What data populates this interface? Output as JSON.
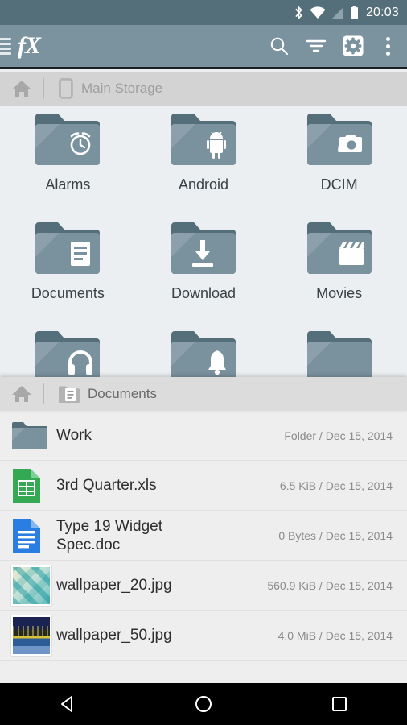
{
  "statusbar": {
    "time": "20:03",
    "icons": [
      "bluetooth-icon",
      "wifi-icon",
      "signal-icon",
      "battery-icon"
    ]
  },
  "appbar": {
    "menu_icon": "hamburger-menu-icon",
    "logo": "fX",
    "actions": [
      {
        "name": "search-button",
        "icon": "search-icon"
      },
      {
        "name": "filter-button",
        "icon": "filter-icon"
      },
      {
        "name": "settings-button",
        "icon": "gear-icon"
      },
      {
        "name": "overflow-button",
        "icon": "more-vertical-icon"
      }
    ]
  },
  "panel_top": {
    "breadcrumb": {
      "home_icon": "home-icon",
      "device_icon": "phone-icon",
      "label": "Main Storage"
    },
    "folders": [
      {
        "label": "Alarms",
        "icon": "alarm-clock-icon"
      },
      {
        "label": "Android",
        "icon": "android-robot-icon"
      },
      {
        "label": "DCIM",
        "icon": "camera-icon"
      },
      {
        "label": "Documents",
        "icon": "document-icon"
      },
      {
        "label": "Download",
        "icon": "download-arrow-icon"
      },
      {
        "label": "Movies",
        "icon": "clapperboard-icon"
      },
      {
        "label": "",
        "icon": "headphones-icon"
      },
      {
        "label": "",
        "icon": "bell-icon"
      },
      {
        "label": "",
        "icon": "plain-folder-icon"
      }
    ]
  },
  "panel_bottom": {
    "breadcrumb": {
      "home_icon": "home-icon",
      "folder_icon": "documents-folder-icon",
      "label": "Documents"
    },
    "files": [
      {
        "name": "Work",
        "meta": "Folder / Dec 15, 2014",
        "icon": "folder-icon"
      },
      {
        "name": "3rd Quarter.xls",
        "meta": "6.5 KiB / Dec 15, 2014",
        "icon": "spreadsheet-icon"
      },
      {
        "name": "Type 19 Widget\nSpec.doc",
        "meta": "0 Bytes / Dec 15, 2014",
        "icon": "word-document-icon"
      },
      {
        "name": "wallpaper_20.jpg",
        "meta": "560.9 KiB / Dec 15, 2014",
        "icon": "image-thumbnail"
      },
      {
        "name": "wallpaper_50.jpg",
        "meta": "4.0 MiB / Dec 15, 2014",
        "icon": "image-thumbnail"
      }
    ]
  },
  "navbar": {
    "buttons": [
      {
        "name": "back-button",
        "icon": "triangle-back-icon"
      },
      {
        "name": "home-button",
        "icon": "circle-home-icon"
      },
      {
        "name": "recents-button",
        "icon": "square-recents-icon"
      }
    ]
  },
  "colors": {
    "statusbar": "#546e7a",
    "appbar": "#7b939f",
    "folder": "#7a929e",
    "folder_tab": "#546e7a",
    "page_bg": "#eceff1",
    "list_bg": "#eeeeee",
    "xls_green": "#34a853",
    "doc_blue": "#2a7de1"
  }
}
